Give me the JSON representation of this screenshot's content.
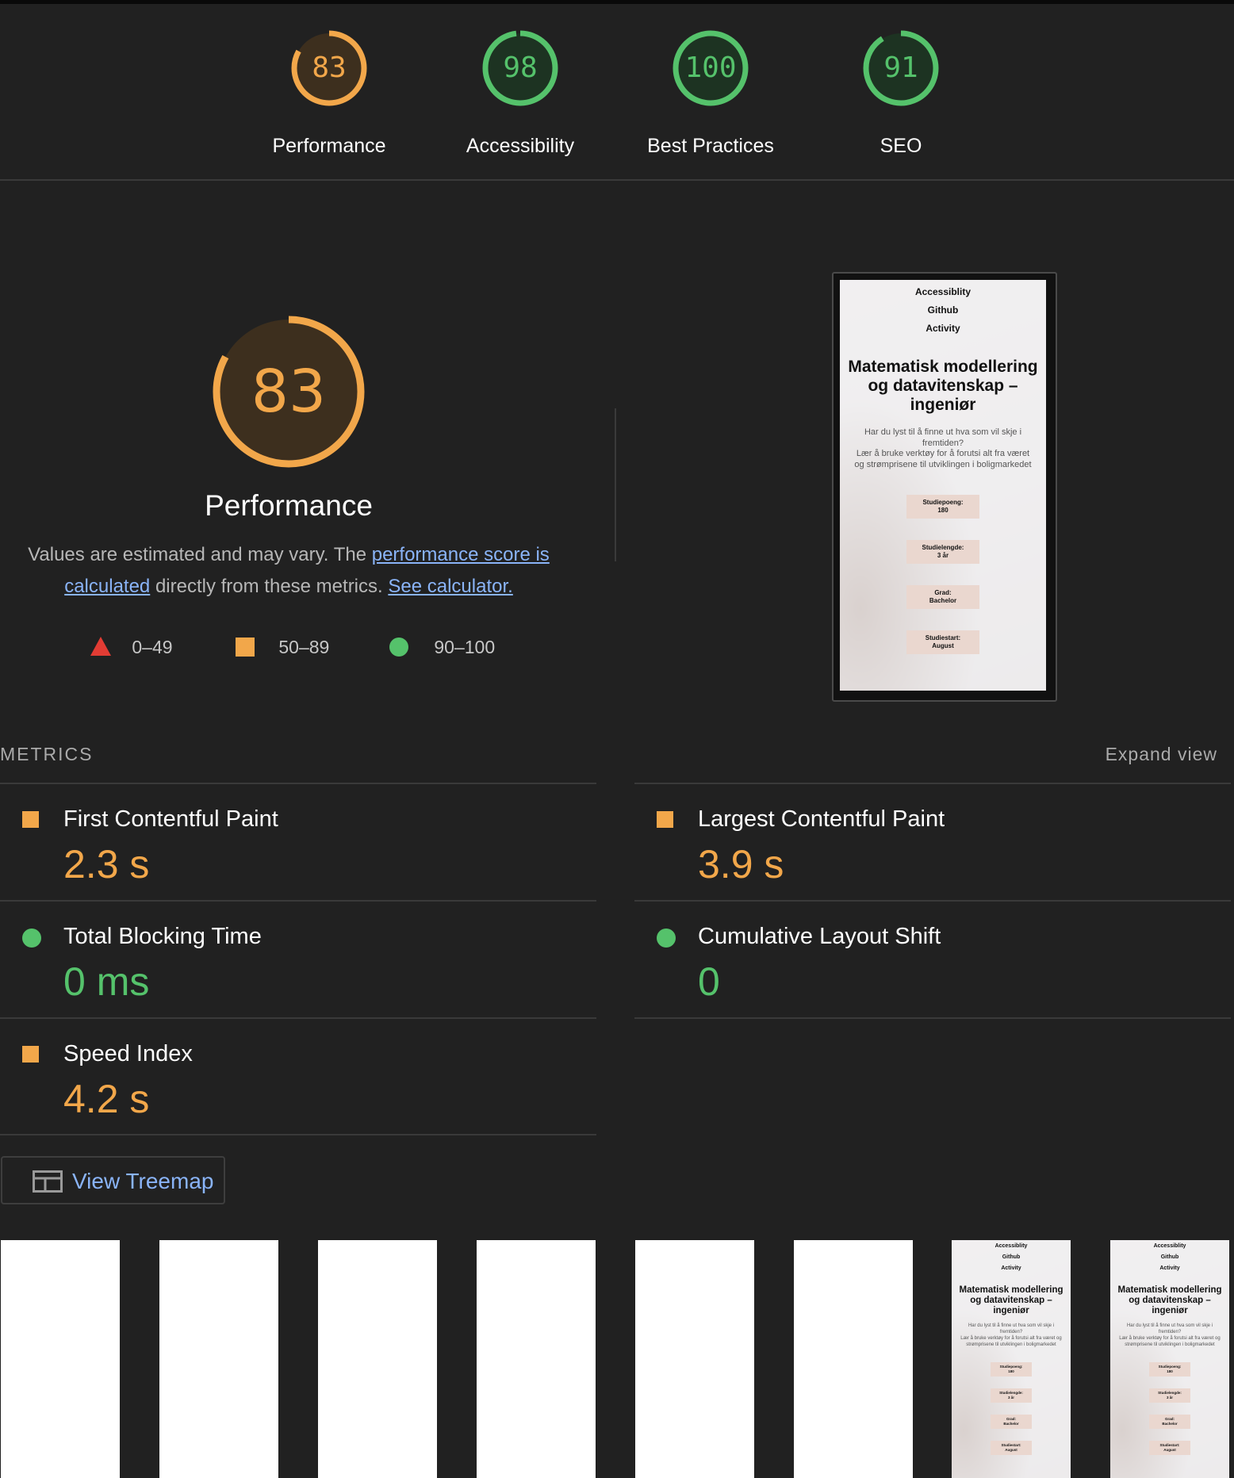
{
  "summary": {
    "categories": [
      {
        "score": "83",
        "label": "Performance",
        "color": "#f2a74a",
        "fraction": 0.83
      },
      {
        "score": "98",
        "label": "Accessibility",
        "color": "#55c26b",
        "fraction": 0.98
      },
      {
        "score": "100",
        "label": "Best Practices",
        "color": "#55c26b",
        "fraction": 1.0
      },
      {
        "score": "91",
        "label": "SEO",
        "color": "#55c26b",
        "fraction": 0.91
      }
    ]
  },
  "performance": {
    "score": "83",
    "fraction": 0.83,
    "title": "Performance",
    "desc_prefix": "Values are estimated and may vary. The ",
    "desc_link1": "performance score is calculated",
    "desc_middle": " directly from these metrics. ",
    "desc_link2": "See calculator.",
    "legend": {
      "fail": "0–49",
      "average": "50–89",
      "pass": "90–100"
    }
  },
  "screenshot": {
    "nav": [
      "Accessiblity",
      "Github",
      "Activity"
    ],
    "title": "Matematisk modellering og datavitenskap – ingeniør",
    "para_line1": "Har du lyst til å finne ut hva som vil skje i fremtiden?",
    "para_line2": "Lær å bruke verktøy for å forutsi alt fra været og strømprisene til utviklingen i boligmarkedet",
    "cards": [
      {
        "label": "Studiepoeng:",
        "value": "180"
      },
      {
        "label": "Studielengde:",
        "value": "3 år"
      },
      {
        "label": "Grad:",
        "value": "Bachelor"
      },
      {
        "label": "Studiestart:",
        "value": "August"
      }
    ]
  },
  "metrics": {
    "header": "METRICS",
    "expand": "Expand view",
    "items": [
      {
        "name": "First Contentful Paint",
        "value": "2.3 s",
        "rating": "average"
      },
      {
        "name": "Largest Contentful Paint",
        "value": "3.9 s",
        "rating": "average"
      },
      {
        "name": "Total Blocking Time",
        "value": "0 ms",
        "rating": "pass"
      },
      {
        "name": "Cumulative Layout Shift",
        "value": "0",
        "rating": "pass"
      },
      {
        "name": "Speed Index",
        "value": "4.2 s",
        "rating": "average"
      }
    ]
  },
  "treemap": {
    "label": "View Treemap",
    "icon": "treemap-icon"
  },
  "colors": {
    "average": "#f2a74a",
    "pass": "#55c26b",
    "fail": "#e23c34",
    "link": "#8ab4f8",
    "background": "#212121"
  }
}
